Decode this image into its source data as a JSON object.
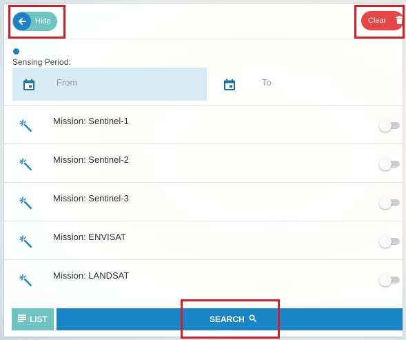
{
  "header": {
    "hide_label": "Hide",
    "clear_label": "Clear"
  },
  "sensing": {
    "label": "Sensing Period:",
    "from_placeholder": "From",
    "to_placeholder": "To"
  },
  "missions": [
    {
      "label": "Mission: Sentinel-1",
      "enabled": false
    },
    {
      "label": "Mission: Sentinel-2",
      "enabled": false
    },
    {
      "label": "Mission: Sentinel-3",
      "enabled": false
    },
    {
      "label": "Mission: ENVISAT",
      "enabled": false
    },
    {
      "label": "Mission: LANDSAT",
      "enabled": false
    }
  ],
  "footer": {
    "list_label": "LIST",
    "search_label": "SEARCH"
  },
  "colors": {
    "accent": "#1a86c8",
    "teal": "#6ec4c0",
    "danger": "#e84646",
    "highlight": "#d32027"
  },
  "icons": {
    "hide": "arrow-left-icon",
    "clear": "trash-icon",
    "date": "calendar-icon",
    "mission": "magic-wand-icon",
    "list": "list-icon",
    "search": "search-icon"
  }
}
